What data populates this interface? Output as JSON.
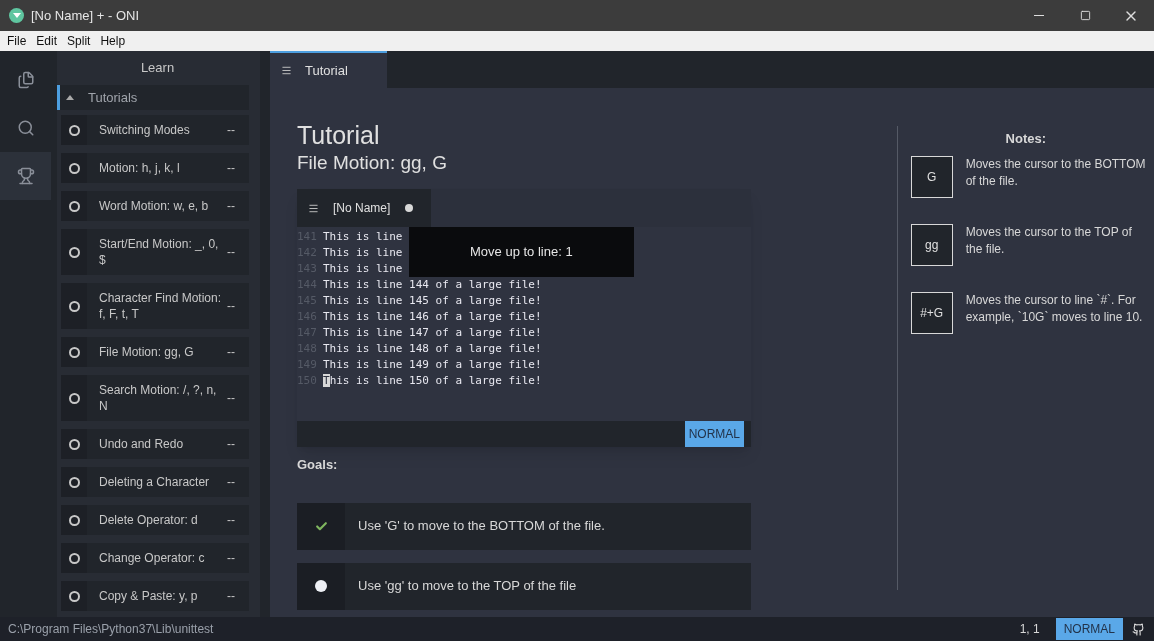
{
  "window": {
    "title": "[No Name] + - ONI"
  },
  "menu": [
    "File",
    "Edit",
    "Split",
    "Help"
  ],
  "activity_bar": [
    {
      "kind": "explorer",
      "selected": false
    },
    {
      "kind": "search",
      "selected": false
    },
    {
      "kind": "learn",
      "selected": true
    }
  ],
  "sidebar": {
    "title": "Learn",
    "section": {
      "label": "Tutorials",
      "expanded": true
    },
    "items": [
      {
        "label": "Switching Modes",
        "status": "--",
        "completed": false
      },
      {
        "label": "Motion: h, j, k, l",
        "status": "--",
        "completed": false
      },
      {
        "label": "Word Motion: w, e, b",
        "status": "--",
        "completed": false
      },
      {
        "label": "Start/End Motion: _, 0, $",
        "status": "--",
        "completed": false
      },
      {
        "label": "Character Find Motion: f, F, t, T",
        "status": "--",
        "completed": false
      },
      {
        "label": "File Motion: gg, G",
        "status": "--",
        "completed": false
      },
      {
        "label": "Search Motion: /, ?, n, N",
        "status": "--",
        "completed": false
      },
      {
        "label": "Undo and Redo",
        "status": "--",
        "completed": false
      },
      {
        "label": "Deleting a Character",
        "status": "--",
        "completed": false
      },
      {
        "label": "Delete Operator: d",
        "status": "--",
        "completed": false
      },
      {
        "label": "Change Operator: c",
        "status": "--",
        "completed": false
      },
      {
        "label": "Copy & Paste: y, p",
        "status": "--",
        "completed": false
      }
    ]
  },
  "tabs": [
    {
      "label": "Tutorial",
      "selected": true
    }
  ],
  "tutorial": {
    "title": "Tutorial",
    "subtitle": "File Motion: gg, G",
    "editor": {
      "tab": "[No Name]",
      "modified": true,
      "lines": [
        {
          "number": "141",
          "text": "This is line"
        },
        {
          "number": "142",
          "text": "This is line"
        },
        {
          "number": "143",
          "text": "This is line"
        },
        {
          "number": "144",
          "text": "This is line 144 of a large file!"
        },
        {
          "number": "145",
          "text": "This is line 145 of a large file!"
        },
        {
          "number": "146",
          "text": "This is line 146 of a large file!"
        },
        {
          "number": "147",
          "text": "This is line 147 of a large file!"
        },
        {
          "number": "148",
          "text": "This is line 148 of a large file!"
        },
        {
          "number": "149",
          "text": "This is line 149 of a large file!"
        },
        {
          "number": "150"
        }
      ],
      "cursor": {
        "char": "T",
        "rest": "his is line 150 of a large file!"
      },
      "tooltip": "Move up to line: 1",
      "mode": "NORMAL"
    },
    "goals_heading": "Goals:",
    "goals": [
      {
        "text": "Use 'G' to move to the BOTTOM of the file.",
        "completed": true
      },
      {
        "text": "Use 'gg' to move to the TOP of the file",
        "completed": false
      }
    ]
  },
  "notes": {
    "title": "Notes:",
    "items": [
      {
        "key": "G",
        "text": "Moves the cursor to the BOTTOM of the file."
      },
      {
        "key": "gg",
        "text": "Moves the cursor to the TOP of the file."
      },
      {
        "key": "#+G",
        "text": "Moves the cursor to line `#`. For example, `10G` moves to line 10."
      }
    ]
  },
  "status_bar": {
    "path": "C:\\Program Files\\Python37\\Lib\\unittest",
    "position": "1, 1",
    "mode": "NORMAL"
  }
}
